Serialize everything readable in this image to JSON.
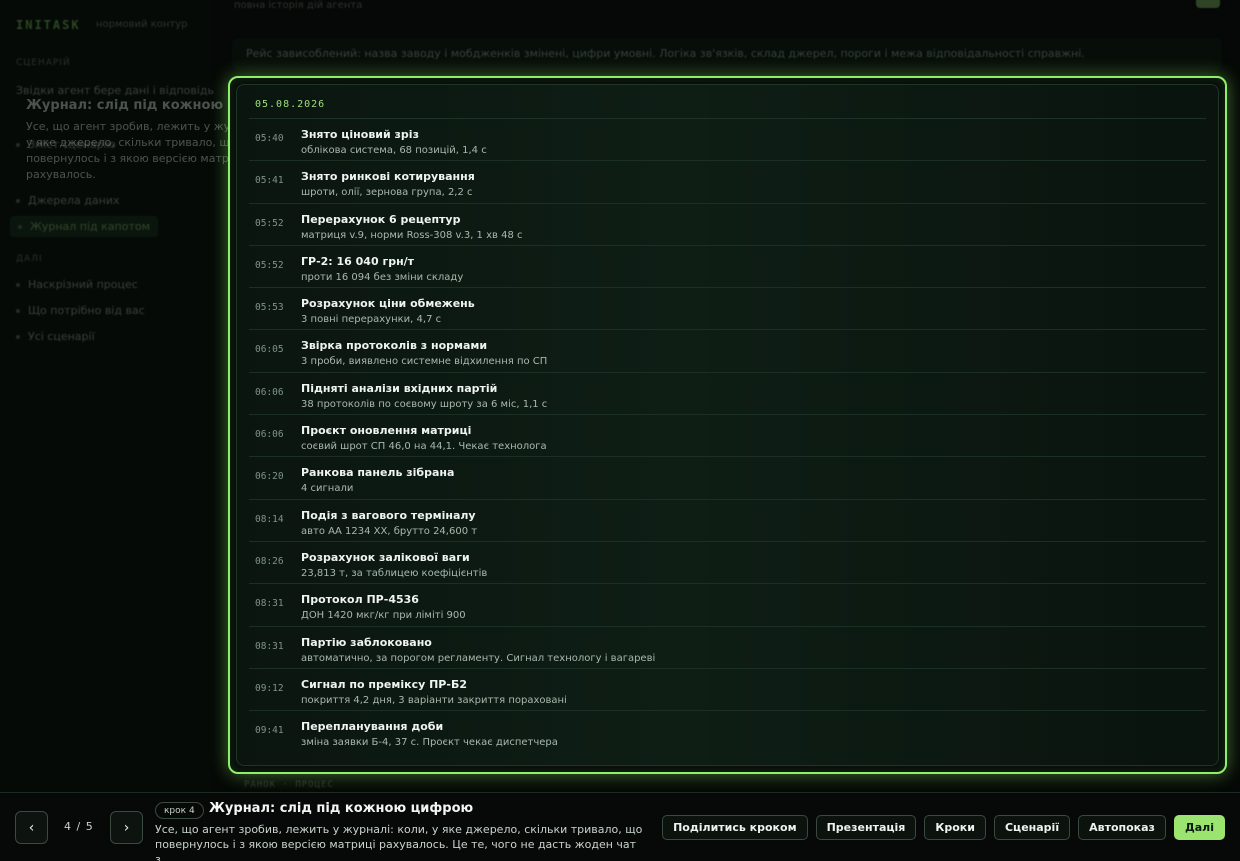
{
  "background": {
    "brand": "INITASK",
    "brand_sub": "нормовий контур",
    "section_scenario": "СЦЕНАРІЙ",
    "nav_scenario": [
      "Звідки агент бере дані і відповідь",
      "Зміст сценарію",
      "Джерела даних",
      "Журнал під капотом"
    ],
    "section_more": "ДАЛІ",
    "nav_more": [
      "Наскрізний процес",
      "Що потрібно від вас",
      "Усі сценарії"
    ],
    "topline": "повна історія дій агента",
    "notice": "Рейс зависоблений: назва заводу і мобдженків змінені, цифри умовні. Логіка зв'язків, склад джерел, пороги і межа відповідальності справжні.",
    "under": "РАНОК · ПРОЦЕС"
  },
  "ghost": {
    "title": "Журнал: слід під кожною цифрою",
    "desc": "Усе, що агент зробив, лежить у журналі: коли, у яке джерело, скільки тривало, що повернулось і з якою версією матриці рахувалось."
  },
  "journal": {
    "date": "05.08.2026",
    "entries": [
      {
        "time": "05:40",
        "title": "Знято ціновий зріз",
        "desc": "облікова система, 68 позицій, 1,4 с"
      },
      {
        "time": "05:41",
        "title": "Знято ринкові котирування",
        "desc": "шроти, олії, зернова група, 2,2 с"
      },
      {
        "time": "05:52",
        "title": "Перерахунок 6 рецептур",
        "desc": "матриця v.9, норми Ross-308 v.3, 1 хв 48 с"
      },
      {
        "time": "05:52",
        "title": "ГР-2: 16 040 грн/т",
        "desc": "проти 16 094 без зміни складу"
      },
      {
        "time": "05:53",
        "title": "Розрахунок ціни обмежень",
        "desc": "3 повні перерахунки, 4,7 с"
      },
      {
        "time": "06:05",
        "title": "Звірка протоколів з нормами",
        "desc": "3 проби, виявлено системне відхилення по СП"
      },
      {
        "time": "06:06",
        "title": "Підняті аналізи вхідних партій",
        "desc": "38 протоколів по соєвому шроту за 6 міс, 1,1 с"
      },
      {
        "time": "06:06",
        "title": "Проєкт оновлення матриці",
        "desc": "соєвий шрот СП 46,0 на 44,1. Чекає технолога"
      },
      {
        "time": "06:20",
        "title": "Ранкова панель зібрана",
        "desc": "4 сигнали"
      },
      {
        "time": "08:14",
        "title": "Подія з вагового терміналу",
        "desc": "авто АА 1234 ХХ, брутто 24,600 т"
      },
      {
        "time": "08:26",
        "title": "Розрахунок залікової ваги",
        "desc": "23,813 т, за таблицею коефіцієнтів"
      },
      {
        "time": "08:31",
        "title": "Протокол ПР-4536",
        "desc": "ДОН 1420 мкг/кг при ліміті 900"
      },
      {
        "time": "08:31",
        "title": "Партію заблоковано",
        "desc": "автоматично, за порогом регламенту. Сигнал технологу і вагареві"
      },
      {
        "time": "09:12",
        "title": "Сигнал по преміксу ПР-Б2",
        "desc": "покриття 4,2 дня, 3 варіанти закриття пораховані"
      },
      {
        "time": "09:41",
        "title": "Перепланування доби",
        "desc": "зміна заявки Б-4, 37 с. Проєкт чекає диспетчера"
      }
    ]
  },
  "bottombar": {
    "prev": "‹",
    "next": "›",
    "counter": "4  /  5",
    "step_badge": "крок 4",
    "step_title": "Журнал: слід під кожною цифрою",
    "step_desc": "Усе, що агент зробив, лежить у журналі: коли, у яке джерело, скільки тривало, що повернулось і з якою версією матриці рахувалось. Це те, чого не дасть жоден чат з...",
    "actions": {
      "share": "Поділитись кроком",
      "presentation": "Презентація",
      "steps": "Кроки",
      "scenarios": "Сценарії",
      "autoplay": "Автопоказ",
      "next": "Далі"
    }
  }
}
